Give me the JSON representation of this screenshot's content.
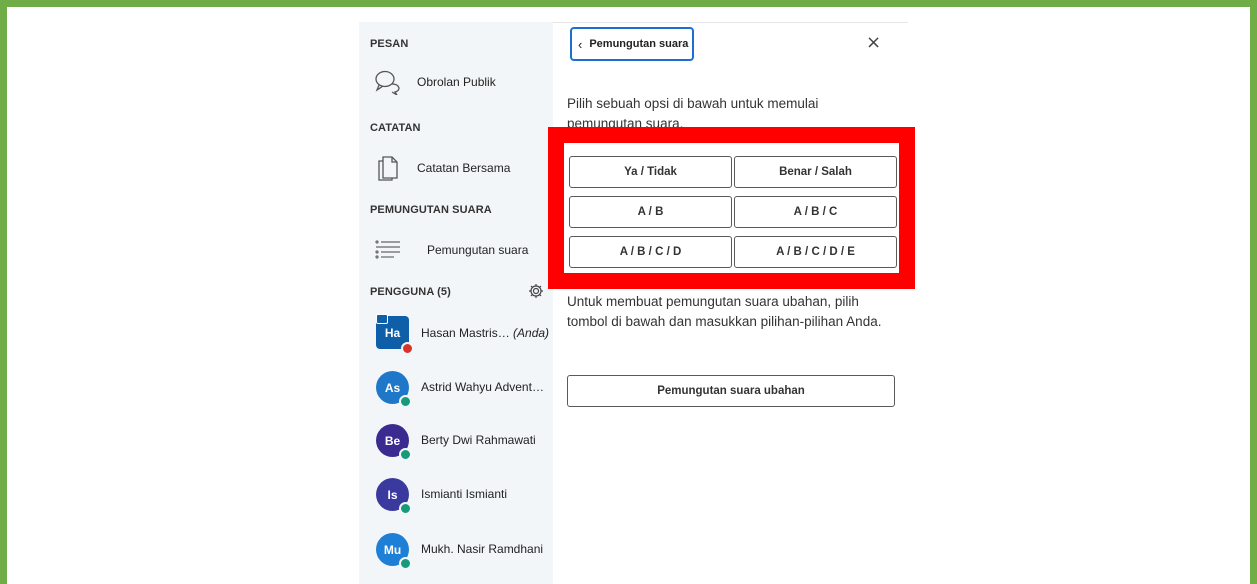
{
  "sidebar": {
    "messages_title": "PESAN",
    "public_chat": "Obrolan Publik",
    "notes_title": "CATATAN",
    "shared_notes": "Catatan Bersama",
    "polling_title": "PEMUNGUTAN SUARA",
    "polling_item": "Pemungutan suara",
    "users_title": "PENGGUNA (5)",
    "users": [
      {
        "initials": "Ha",
        "name": "Hasan Mastris…",
        "suffix": "(Anda)",
        "color": "#0f5fa8"
      },
      {
        "initials": "As",
        "name": "Astrid Wahyu Advent…",
        "suffix": "",
        "color": "#1f77c9"
      },
      {
        "initials": "Be",
        "name": "Berty Dwi Rahmawati",
        "suffix": "",
        "color": "#3b2a8f"
      },
      {
        "initials": "Is",
        "name": "Ismianti Ismianti",
        "suffix": "",
        "color": "#3a3a9e"
      },
      {
        "initials": "Mu",
        "name": "Mukh. Nasir Ramdhani",
        "suffix": "",
        "color": "#1d7fd6"
      }
    ]
  },
  "panel": {
    "back_label": "Pemungutan suara",
    "intro": "Pilih sebuah opsi di bawah untuk memulai pemungutan suara.",
    "options": [
      "Ya / Tidak",
      "Benar / Salah",
      "A / B",
      "A / B / C",
      "A / B / C / D",
      "A / B / C / D / E"
    ],
    "custom_text": "Untuk membuat pemungutan suara ubahan, pilih tombol di bawah dan masukkan pilihan-pilihan Anda.",
    "custom_button": "Pemungutan suara ubahan"
  },
  "colors": {
    "frame": "#70ad47",
    "highlight": "#ff0000",
    "focus": "#1b6fd1",
    "mic_muted": "#d9342b",
    "mic_listen": "#159a7c"
  }
}
